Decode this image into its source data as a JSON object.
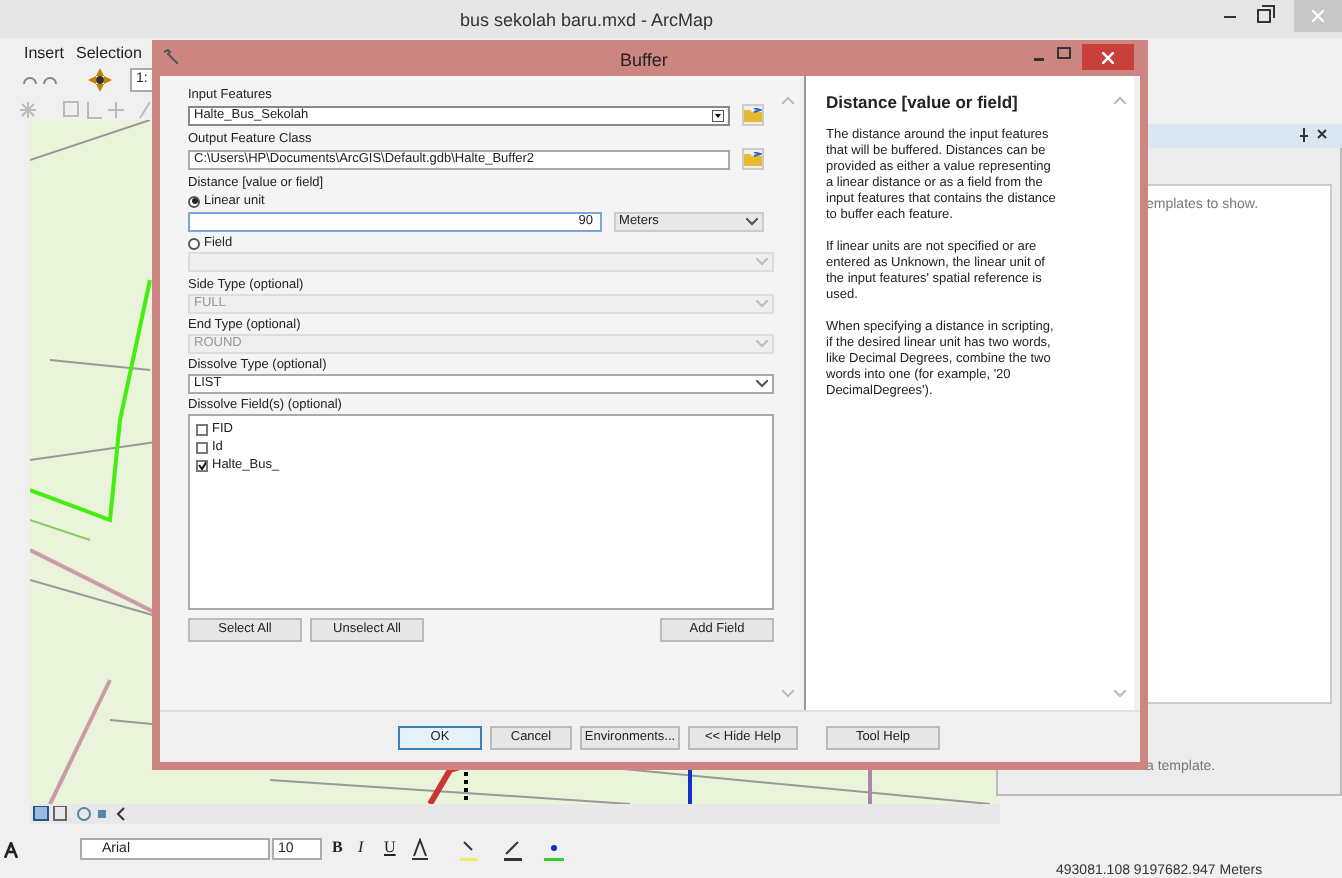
{
  "app": {
    "title": "bus sekolah baru.mxd - ArcMap",
    "menu": [
      "Insert",
      "Selection"
    ],
    "scale_field": "1:",
    "template_hint": "emplates to show.",
    "template_note": "a template.",
    "font_name": "Arial",
    "font_size": "10",
    "format_buttons": [
      "B",
      "I",
      "U"
    ],
    "status": "493081.108  9197682.947 Meters"
  },
  "dialog": {
    "title": "Buffer",
    "input_label": "Input Features",
    "input_value": "Halte_Bus_Sekolah",
    "output_label": "Output Feature Class",
    "output_value": "C:\\Users\\HP\\Documents\\ArcGIS\\Default.gdb\\Halte_Buffer2",
    "distance_label": "Distance [value or field]",
    "distance_options": [
      {
        "label": "Linear unit",
        "selected": true
      },
      {
        "label": "Field",
        "selected": false
      }
    ],
    "distance_value": "90",
    "unit": "Meters",
    "side_label": "Side Type (optional)",
    "side_value": "FULL",
    "end_label": "End Type (optional)",
    "end_value": "ROUND",
    "dissolve_label": "Dissolve Type (optional)",
    "dissolve_value": "LIST",
    "fields_label": "Dissolve Field(s) (optional)",
    "fields": [
      {
        "label": "FID",
        "checked": false
      },
      {
        "label": "Id",
        "checked": false
      },
      {
        "label": "Halte_Bus_",
        "checked": true
      }
    ],
    "list_buttons": [
      "Select All",
      "Unselect All",
      "Add Field"
    ],
    "footer_buttons": [
      {
        "label": "OK",
        "kind": "default"
      },
      {
        "label": "Cancel",
        "kind": "normal"
      },
      {
        "label": "Environments...",
        "kind": "normal"
      },
      {
        "label": "<< Hide Help",
        "kind": "normal"
      },
      {
        "label": "Tool Help",
        "kind": "normal"
      }
    ],
    "help": {
      "heading": "Distance [value or field]",
      "paragraphs": [
        "The distance around the input features that will be buffered. Distances can be provided as either a value representing a linear distance or as a field from the input features that contains the distance to buffer each feature.",
        "If linear units are not specified or are entered as Unknown, the linear unit of the input features' spatial reference is used.",
        "When specifying a distance in scripting, if the desired linear unit has two words, like Decimal Degrees, combine the two words into one (for example, '20 DecimalDegrees')."
      ]
    }
  }
}
